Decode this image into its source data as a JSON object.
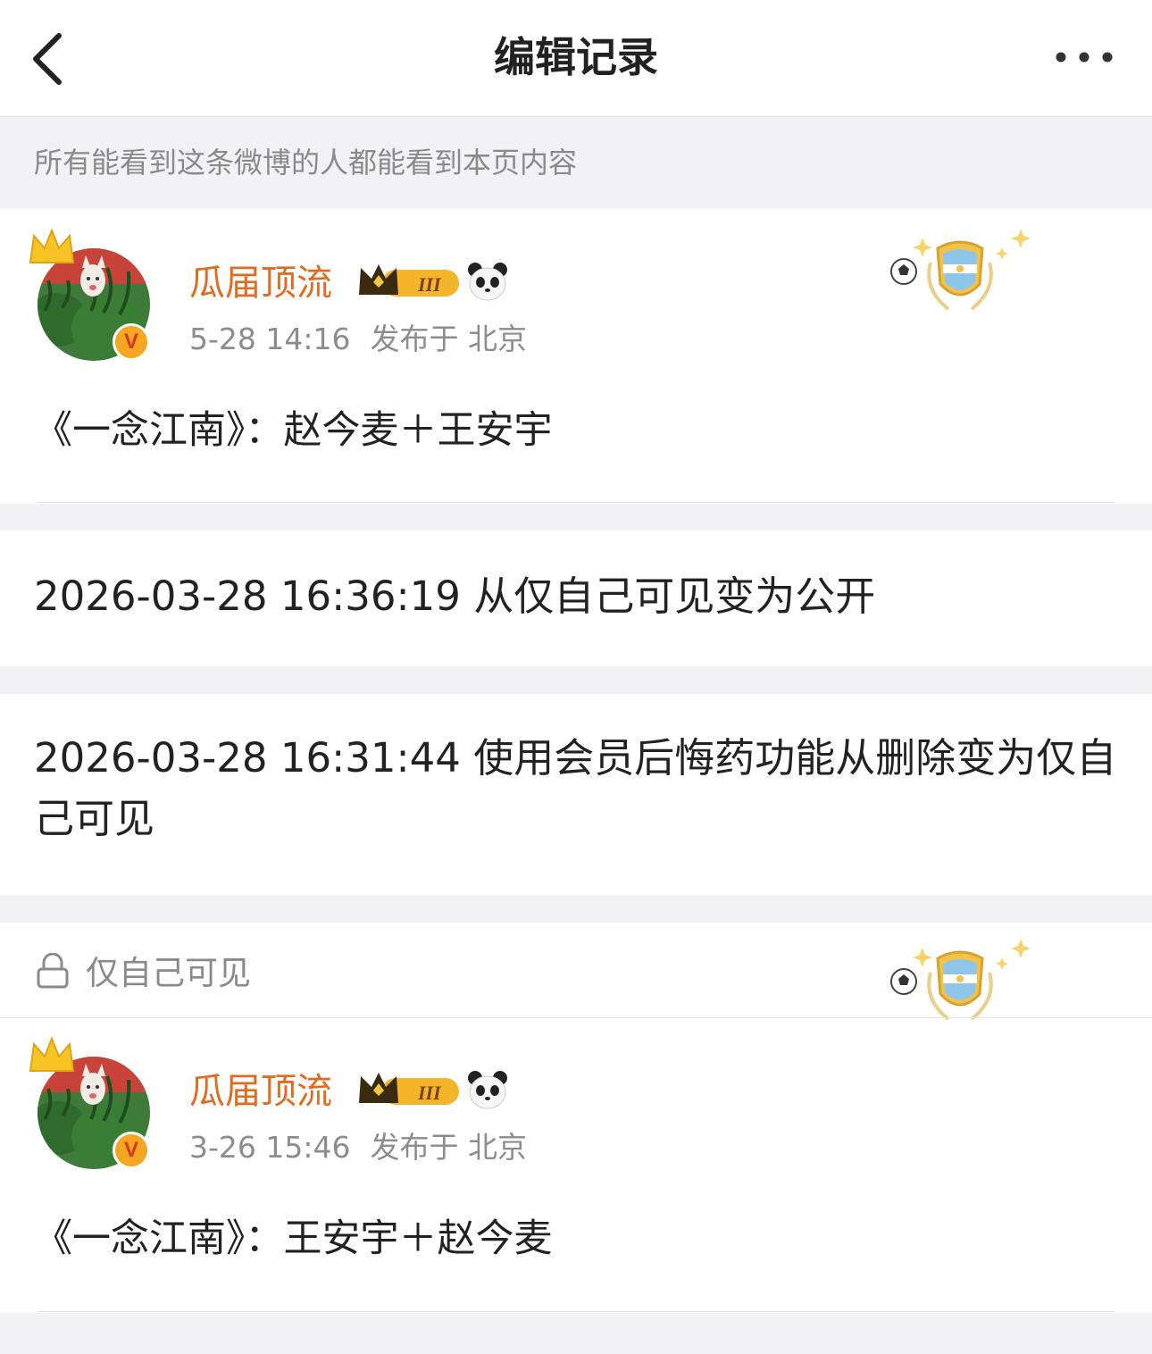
{
  "nav": {
    "title": "编辑记录",
    "back_icon": "chevron-left-icon",
    "more_icon": "more-dots-icon"
  },
  "notice": "所有能看到这条微博的人都能看到本页内容",
  "posts": [
    {
      "username": "瓜届顶流",
      "time": "5-28 14:16",
      "location": "发布于 北京",
      "content": "《一念江南》：赵今麦＋王安宇",
      "badges": [
        "crown-level-3-badge",
        "panda-icon"
      ],
      "decoration": "argentina-football-shield-badge"
    },
    {
      "visibility": "仅自己可见",
      "username": "瓜届顶流",
      "time": "3-26 15:46",
      "location": "发布于 北京",
      "content": "《一念江南》：王安宇＋赵今麦",
      "badges": [
        "crown-level-3-badge",
        "panda-icon"
      ],
      "decoration": "argentina-football-shield-badge"
    }
  ],
  "logs": [
    "2026-03-28 16:36:19 从仅自己可见变为公开",
    "2026-03-28 16:31:44 使用会员后悔药功能从删除变为仅自己可见"
  ],
  "colors": {
    "username": "#e26b1f",
    "background": "#f2f2f4",
    "verified_badge": "#f5a623"
  }
}
